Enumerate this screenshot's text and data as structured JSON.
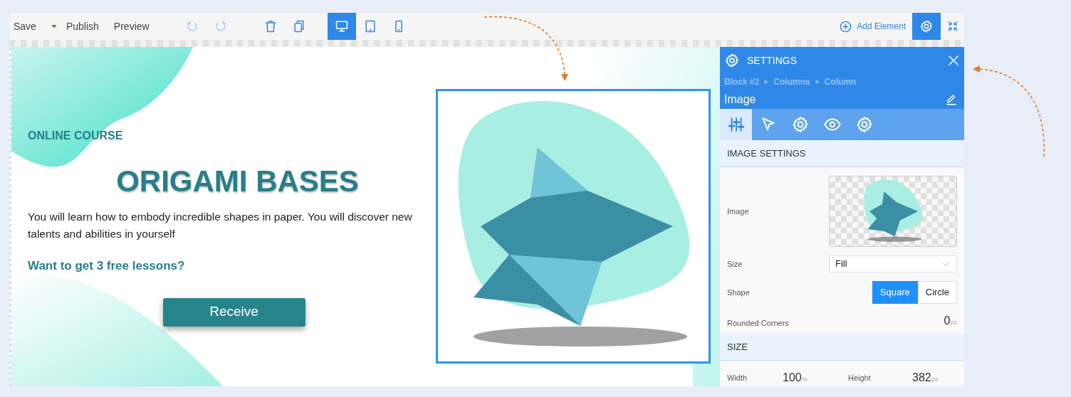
{
  "toolbar": {
    "actions": [
      "Save",
      "Publish",
      "Preview"
    ],
    "device_tabs": [
      {
        "selected": true
      },
      {
        "selected": false
      },
      {
        "selected": false
      }
    ],
    "add_element": "Add Element",
    "settings_button": {
      "selected": true
    }
  },
  "canvas": {
    "eyebrow": "ONLINE COURSE",
    "title": "ORIGAMI BASES",
    "description": "You will learn how to embody incredible shapes in paper. You will discover new talents and abilities in yourself",
    "question": "Want to get 3 free lessons?",
    "button": "Receive",
    "image": {
      "selected": true
    }
  },
  "settings": {
    "title": "SETTINGS",
    "breadcrumb": [
      "Block #2",
      "Columns",
      "Column"
    ],
    "element_title": "Image",
    "tabs": [
      {
        "selected": true
      },
      {
        "selected": false
      },
      {
        "selected": false
      },
      {
        "selected": false
      },
      {
        "selected": false
      }
    ],
    "sections": [
      {
        "title": "IMAGE SETTINGS",
        "fields": [
          {
            "kind": "image",
            "label": "Image"
          },
          {
            "kind": "select",
            "label": "Size",
            "value": "Fill"
          },
          {
            "kind": "segmented",
            "label": "Shape",
            "options": [
              {
                "label": "Square",
                "selected": true
              },
              {
                "label": "Circle",
                "selected": false
              }
            ]
          },
          {
            "kind": "number",
            "label": "Rounded Corners",
            "value": "0",
            "unit": "px"
          }
        ]
      },
      {
        "title": "SIZE",
        "fields": [
          {
            "kind": "pair",
            "items": [
              {
                "label": "Width",
                "value": "100",
                "unit": "%"
              },
              {
                "label": "Height",
                "value": "382",
                "unit": "px"
              }
            ]
          }
        ]
      }
    ]
  }
}
